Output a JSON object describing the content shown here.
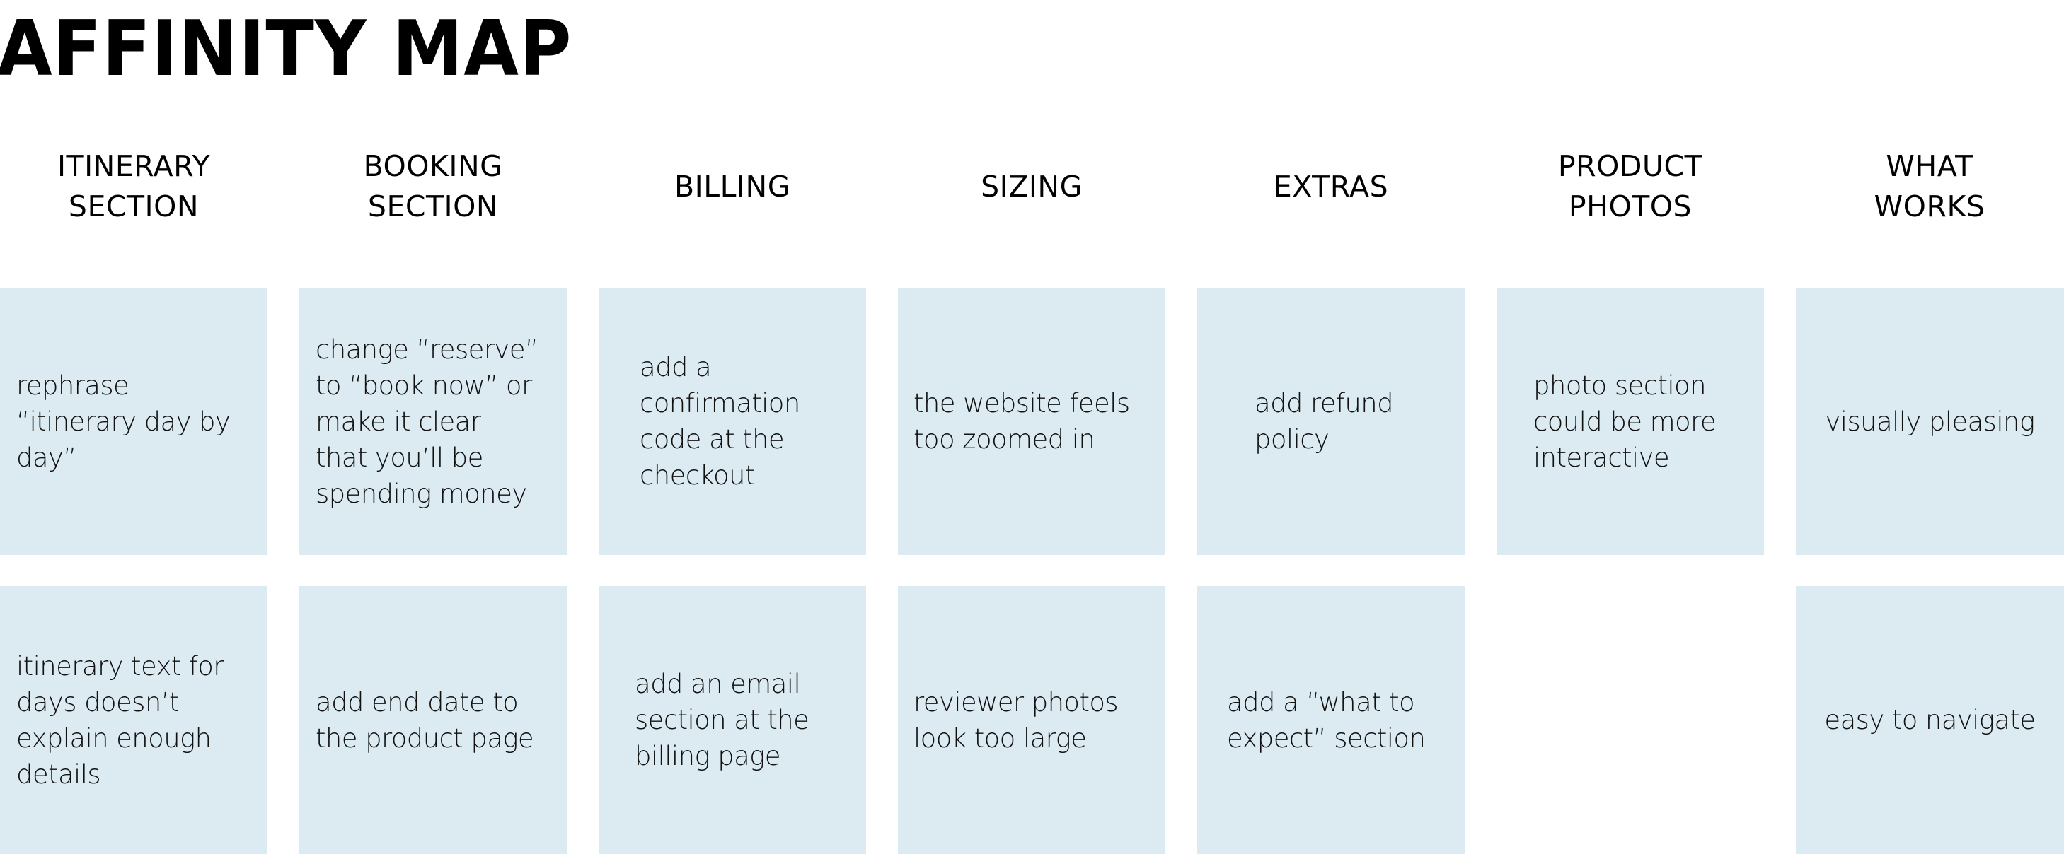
{
  "title": "AFFINITY MAP",
  "colors": {
    "card_background": "#dceaf1",
    "page_background": "#ffffff",
    "text": "#000000"
  },
  "columns": [
    {
      "header": "ITINERARY\nSECTION",
      "notes": [
        "rephrase\n“itinerary day by\nday”",
        "itinerary text for\ndays doesn’t\nexplain enough\ndetails"
      ]
    },
    {
      "header": "BOOKING\nSECTION",
      "notes": [
        "change “reserve”\nto “book now” or\nmake it clear\nthat you’ll be\nspending money",
        "add end date to\nthe product page"
      ]
    },
    {
      "header": "BILLING",
      "notes": [
        "add a\nconfirmation\ncode at the\ncheckout",
        "add an email\nsection at the\nbilling page"
      ]
    },
    {
      "header": "SIZING",
      "notes": [
        "the website feels\ntoo zoomed in",
        "reviewer photos\nlook too large"
      ]
    },
    {
      "header": "EXTRAS",
      "notes": [
        "add refund\npolicy",
        "add a “what to\nexpect” section"
      ]
    },
    {
      "header": "PRODUCT\nPHOTOS",
      "notes": [
        "photo section\ncould be more\ninteractive"
      ]
    },
    {
      "header": "WHAT\nWORKS",
      "notes": [
        "visually pleasing",
        "easy to navigate"
      ]
    }
  ]
}
